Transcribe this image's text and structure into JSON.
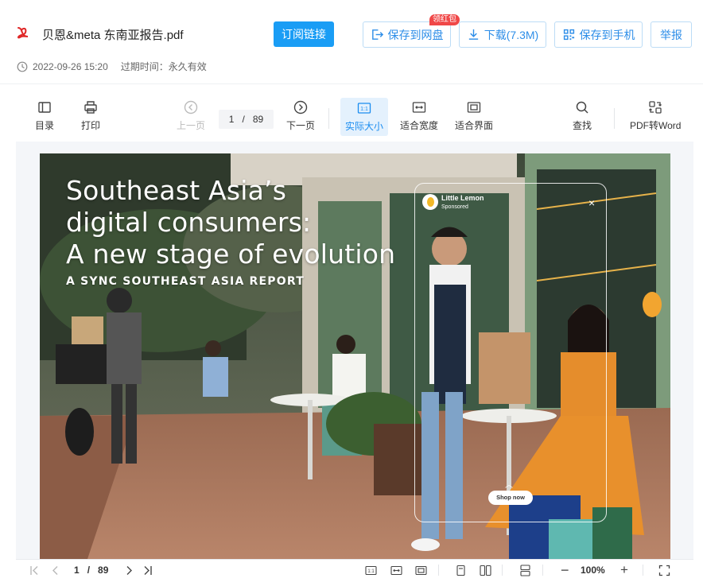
{
  "header": {
    "file_name": "贝恩&meta 东南亚报告.pdf",
    "subscribe_label": "订阅链接",
    "save_disk_label": "保存到网盘",
    "red_badge": "领红包",
    "download_label": "下载(7.3M)",
    "save_phone_label": "保存到手机",
    "report_label": "举报",
    "date": "2022-09-26 15:20",
    "expire": "过期时间：永久有效"
  },
  "toolbar": {
    "toc_label": "目录",
    "print_label": "打印",
    "prev_label": "上一页",
    "current_page": "1",
    "page_sep": "/",
    "total_pages": "89",
    "next_label": "下一页",
    "actual_size_label": "实际大小",
    "actual_size_icon_text": "1:1",
    "fit_width_label": "适合宽度",
    "fit_page_label": "适合界面",
    "find_label": "查找",
    "pdf_to_word_label": "PDF转Word"
  },
  "cover": {
    "title": "Southeast Asia’s\ndigital consumers:\nA new stage of evolution",
    "subtitle": "A SYNC SOUTHEAST ASIA REPORT",
    "ad_name": "Little Lemon",
    "ad_sponsored": "Sponsored",
    "ad_close": "×",
    "ad_chevron": "︿",
    "shop_now": "Shop now"
  },
  "bottombar": {
    "current_page": "1",
    "page_sep": "/",
    "total_pages": "89",
    "zoom": "100%",
    "zoom_out": "−",
    "zoom_in": "+"
  },
  "colors": {
    "accent": "#1a9df5",
    "link_blue": "#2e8ee8",
    "badge_red": "#f04848",
    "pdf_red": "#e02828",
    "active_bg": "#e4f1fd"
  },
  "icons": {
    "file": "pdf-icon",
    "save_disk": "save-to-disk-icon",
    "download": "download-icon",
    "save_phone": "qr-code-icon",
    "clock": "clock-icon",
    "toc": "toc-icon",
    "print": "printer-icon",
    "prev": "circle-left-icon",
    "next": "circle-right-icon",
    "fit_width": "fit-width-icon",
    "fit_page": "fit-page-icon",
    "find": "search-icon",
    "pdf_to_word": "convert-icon"
  }
}
